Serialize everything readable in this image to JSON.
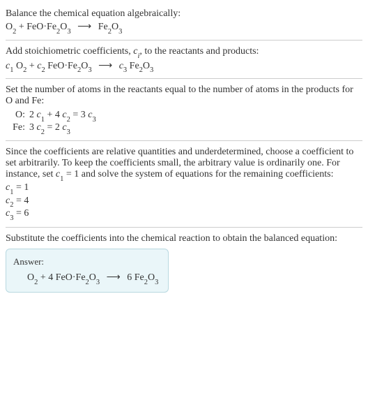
{
  "section1": {
    "title": "Balance the chemical equation algebraically:",
    "equation_html": "O<span class=\"sub\">2</span> + FeO·Fe<span class=\"sub\">2</span>O<span class=\"sub\">3</span> <span class=\"arrow\">⟶</span> Fe<span class=\"sub\">2</span>O<span class=\"sub\">3</span>"
  },
  "section2": {
    "title_html": "Add stoichiometric coefficients, <span class=\"ital\">c<span class=\"sub\">i</span></span>, to the reactants and products:",
    "equation_html": "<span class=\"ital\">c</span><span class=\"sub\">1</span> O<span class=\"sub\">2</span> + <span class=\"ital\">c</span><span class=\"sub\">2</span> FeO·Fe<span class=\"sub\">2</span>O<span class=\"sub\">3</span> <span class=\"arrow\">⟶</span> <span class=\"ital\">c</span><span class=\"sub\">3</span> Fe<span class=\"sub\">2</span>O<span class=\"sub\">3</span>"
  },
  "section3": {
    "title": "Set the number of atoms in the reactants equal to the number of atoms in the products for O and Fe:",
    "rows": [
      {
        "label": "O:",
        "eqn_html": "2 <span class=\"ital\">c</span><span class=\"sub\">1</span> + 4 <span class=\"ital\">c</span><span class=\"sub\">2</span> = 3 <span class=\"ital\">c</span><span class=\"sub\">3</span>"
      },
      {
        "label": "Fe:",
        "eqn_html": "3 <span class=\"ital\">c</span><span class=\"sub\">2</span> = 2 <span class=\"ital\">c</span><span class=\"sub\">3</span>"
      }
    ]
  },
  "section4": {
    "para_html": "Since the coefficients are relative quantities and underdetermined, choose a coefficient to set arbitrarily. To keep the coefficients small, the arbitrary value is ordinarily one. For instance, set <span class=\"ital\">c</span><span class=\"sub\">1</span> = 1 and solve the system of equations for the remaining coefficients:",
    "coeffs": [
      "<span class=\"ital\">c</span><span class=\"sub\">1</span> = 1",
      "<span class=\"ital\">c</span><span class=\"sub\">2</span> = 4",
      "<span class=\"ital\">c</span><span class=\"sub\">3</span> = 6"
    ]
  },
  "section5": {
    "title": "Substitute the coefficients into the chemical reaction to obtain the balanced equation:",
    "answer_label": "Answer:",
    "answer_html": "O<span class=\"sub\">2</span> + 4 FeO·Fe<span class=\"sub\">2</span>O<span class=\"sub\">3</span> <span class=\"arrow\">⟶</span> 6 Fe<span class=\"sub\">2</span>O<span class=\"sub\">3</span>"
  }
}
